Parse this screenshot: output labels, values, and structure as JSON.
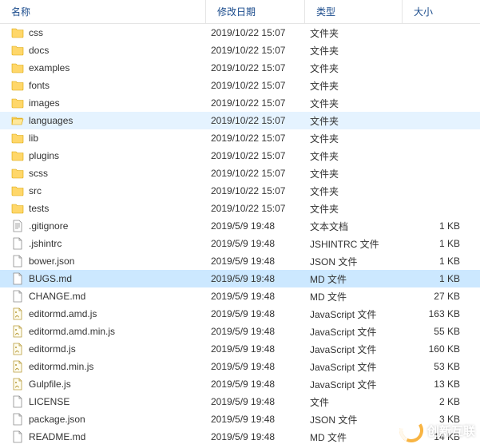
{
  "columns": {
    "name": "名称",
    "date": "修改日期",
    "type": "类型",
    "size": "大小"
  },
  "rows": [
    {
      "icon": "folder",
      "name": "css",
      "date": "2019/10/22 15:07",
      "type": "文件夹",
      "size": "",
      "state": ""
    },
    {
      "icon": "folder",
      "name": "docs",
      "date": "2019/10/22 15:07",
      "type": "文件夹",
      "size": "",
      "state": ""
    },
    {
      "icon": "folder",
      "name": "examples",
      "date": "2019/10/22 15:07",
      "type": "文件夹",
      "size": "",
      "state": ""
    },
    {
      "icon": "folder",
      "name": "fonts",
      "date": "2019/10/22 15:07",
      "type": "文件夹",
      "size": "",
      "state": ""
    },
    {
      "icon": "folder",
      "name": "images",
      "date": "2019/10/22 15:07",
      "type": "文件夹",
      "size": "",
      "state": ""
    },
    {
      "icon": "folder-open",
      "name": "languages",
      "date": "2019/10/22 15:07",
      "type": "文件夹",
      "size": "",
      "state": "hovered"
    },
    {
      "icon": "folder",
      "name": "lib",
      "date": "2019/10/22 15:07",
      "type": "文件夹",
      "size": "",
      "state": ""
    },
    {
      "icon": "folder",
      "name": "plugins",
      "date": "2019/10/22 15:07",
      "type": "文件夹",
      "size": "",
      "state": ""
    },
    {
      "icon": "folder",
      "name": "scss",
      "date": "2019/10/22 15:07",
      "type": "文件夹",
      "size": "",
      "state": ""
    },
    {
      "icon": "folder",
      "name": "src",
      "date": "2019/10/22 15:07",
      "type": "文件夹",
      "size": "",
      "state": ""
    },
    {
      "icon": "folder",
      "name": "tests",
      "date": "2019/10/22 15:07",
      "type": "文件夹",
      "size": "",
      "state": ""
    },
    {
      "icon": "text",
      "name": ".gitignore",
      "date": "2019/5/9 19:48",
      "type": "文本文档",
      "size": "1 KB",
      "state": ""
    },
    {
      "icon": "file",
      "name": ".jshintrc",
      "date": "2019/5/9 19:48",
      "type": "JSHINTRC 文件",
      "size": "1 KB",
      "state": ""
    },
    {
      "icon": "file",
      "name": "bower.json",
      "date": "2019/5/9 19:48",
      "type": "JSON 文件",
      "size": "1 KB",
      "state": ""
    },
    {
      "icon": "file",
      "name": "BUGS.md",
      "date": "2019/5/9 19:48",
      "type": "MD 文件",
      "size": "1 KB",
      "state": "selected"
    },
    {
      "icon": "file",
      "name": "CHANGE.md",
      "date": "2019/5/9 19:48",
      "type": "MD 文件",
      "size": "27 KB",
      "state": ""
    },
    {
      "icon": "script",
      "name": "editormd.amd.js",
      "date": "2019/5/9 19:48",
      "type": "JavaScript 文件",
      "size": "163 KB",
      "state": ""
    },
    {
      "icon": "script",
      "name": "editormd.amd.min.js",
      "date": "2019/5/9 19:48",
      "type": "JavaScript 文件",
      "size": "55 KB",
      "state": ""
    },
    {
      "icon": "script",
      "name": "editormd.js",
      "date": "2019/5/9 19:48",
      "type": "JavaScript 文件",
      "size": "160 KB",
      "state": ""
    },
    {
      "icon": "script",
      "name": "editormd.min.js",
      "date": "2019/5/9 19:48",
      "type": "JavaScript 文件",
      "size": "53 KB",
      "state": ""
    },
    {
      "icon": "script",
      "name": "Gulpfile.js",
      "date": "2019/5/9 19:48",
      "type": "JavaScript 文件",
      "size": "13 KB",
      "state": ""
    },
    {
      "icon": "file",
      "name": "LICENSE",
      "date": "2019/5/9 19:48",
      "type": "文件",
      "size": "2 KB",
      "state": ""
    },
    {
      "icon": "file",
      "name": "package.json",
      "date": "2019/5/9 19:48",
      "type": "JSON 文件",
      "size": "3 KB",
      "state": ""
    },
    {
      "icon": "file",
      "name": "README.md",
      "date": "2019/5/9 19:48",
      "type": "MD 文件",
      "size": "14 KB",
      "state": ""
    }
  ],
  "watermark": {
    "text": "创新互联"
  }
}
